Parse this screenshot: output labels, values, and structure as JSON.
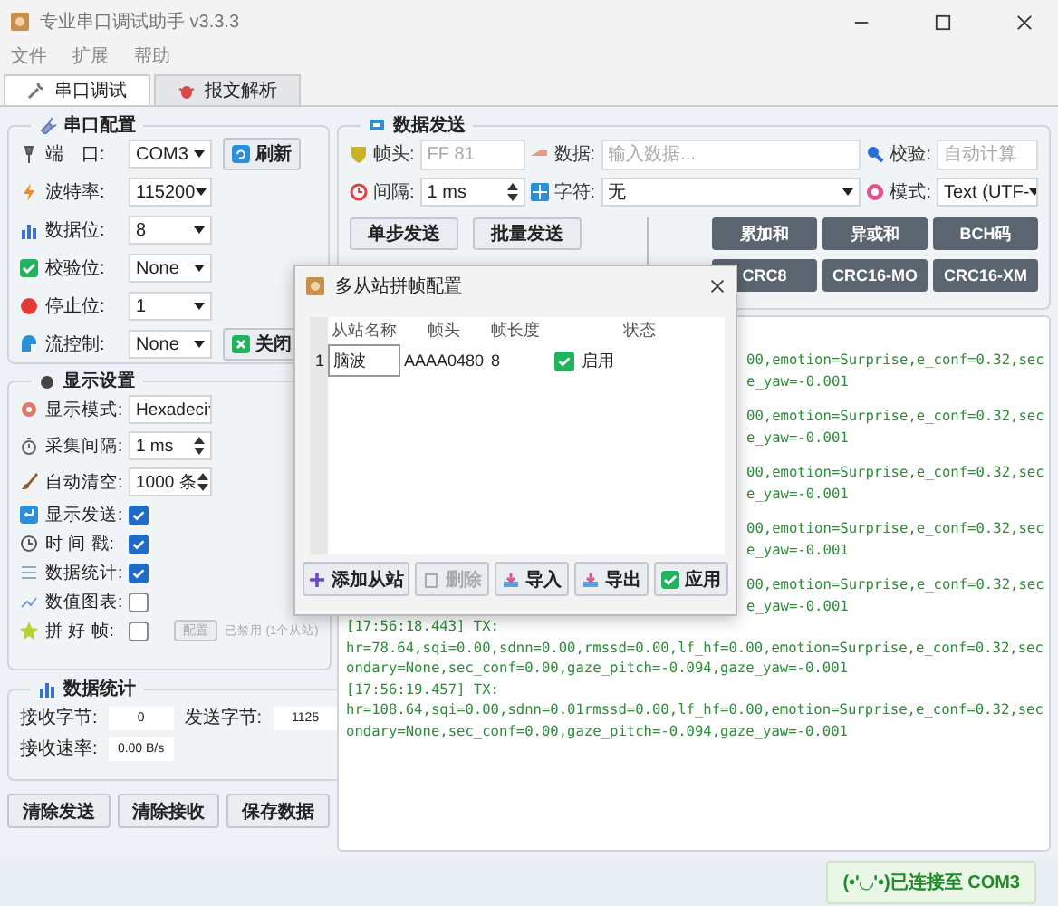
{
  "window": {
    "title": "专业串口调试助手 v3.3.3"
  },
  "menu": [
    "文件",
    "扩展",
    "帮助"
  ],
  "tabs": [
    {
      "label": "串口调试",
      "selected": true
    },
    {
      "label": "报文解析",
      "selected": false
    }
  ],
  "serial_config": {
    "title": "串口配置",
    "fields": [
      {
        "label": "端　口:",
        "value": "COM3"
      },
      {
        "label": "波特率:",
        "value": "115200"
      },
      {
        "label": "数据位:",
        "value": "8"
      },
      {
        "label": "校验位:",
        "value": "None"
      },
      {
        "label": "停止位:",
        "value": "1"
      },
      {
        "label": "流控制:",
        "value": "None"
      }
    ],
    "refresh_button": "刷新",
    "close_button": "关闭"
  },
  "display_settings": {
    "title": "显示设置",
    "mode": {
      "label": "显示模式:",
      "value": "Hexadeci"
    },
    "spins": [
      {
        "label": "采集间隔:",
        "value": "1 ms"
      },
      {
        "label": "自动清空:",
        "value": "1000 条"
      }
    ],
    "checks": [
      {
        "label": "显示发送:",
        "checked": true
      },
      {
        "label": "时 间 戳:",
        "checked": true
      },
      {
        "label": "数据统计:",
        "checked": true
      },
      {
        "label": "数值图表:",
        "checked": false
      },
      {
        "label": "拼 好 帧:",
        "checked": false
      }
    ],
    "frame_config_button": {
      "label": "配置",
      "disabled": true
    },
    "frame_status": "已禁用 (1个从站)"
  },
  "stats": {
    "title": "数据统计",
    "rows": [
      {
        "label": "接收字节:",
        "value": "0"
      },
      {
        "label": "发送字节:",
        "value": "1125"
      },
      {
        "label": "接收速率:",
        "value": "0.00 B/s"
      }
    ]
  },
  "actions": [
    "清除发送",
    "清除接收",
    "保存数据"
  ],
  "send": {
    "title": "数据发送",
    "header": {
      "label": "帧头:",
      "placeholder": "FF 81"
    },
    "data": {
      "label": "数据:",
      "placeholder": "输入数据..."
    },
    "checksum": {
      "label": "校验:",
      "placeholder": "自动计算"
    },
    "interval": {
      "label": "间隔:",
      "value": "1 ms"
    },
    "charset": {
      "label": "字符:",
      "value": "无"
    },
    "mode": {
      "label": "模式:",
      "value": "Text (UTF-"
    },
    "send_buttons": [
      "单步发送",
      "批量发送"
    ],
    "checksum_buttons": [
      "累加和",
      "异或和",
      "BCH码",
      "CRC8",
      "CRC16-MO",
      "CRC16-XM"
    ]
  },
  "log": [
    {
      "kind": "fragment",
      "lines": [
        "00,emotion=Surprise,e_conf=0.32,sec",
        "e_yaw=-0.001"
      ]
    },
    {
      "kind": "fragment",
      "lines": [
        "00,emotion=Surprise,e_conf=0.32,sec",
        "e_yaw=-0.001"
      ]
    },
    {
      "kind": "fragment",
      "lines": [
        "00,emotion=Surprise,e_conf=0.32,sec",
        "e_yaw=-0.001"
      ]
    },
    {
      "kind": "fragment",
      "lines": [
        "00,emotion=Surprise,e_conf=0.32,sec",
        "e_yaw=-0.001"
      ]
    },
    {
      "kind": "fragment",
      "lines": [
        "00,emotion=Surprise,e_conf=0.32,sec",
        "e_yaw=-0.001"
      ]
    },
    {
      "kind": "full",
      "lines": [
        "[17:56:18.443] TX:",
        "hr=78.64,sqi=0.00,sdnn=0.00,rmssd=0.00,lf_hf=0.00,emotion=Surprise,e_conf=0.32,sec",
        "ondary=None,sec_conf=0.00,gaze_pitch=-0.094,gaze_yaw=-0.001"
      ]
    },
    {
      "kind": "full",
      "lines": [
        "[17:56:19.457] TX:",
        "hr=108.64,sqi=0.00,sdnn=0.01rmssd=0.00,lf_hf=0.00,emotion=Surprise,e_conf=0.32,sec",
        "ondary=None,sec_conf=0.00,gaze_pitch=-0.094,gaze_yaw=-0.001"
      ]
    }
  ],
  "dialog": {
    "title": "多从站拼帧配置",
    "columns": [
      "从站名称",
      "帧头",
      "帧长度",
      "状态"
    ],
    "rows": [
      {
        "index": "1",
        "name": "脑波",
        "header": "AAAA0480",
        "length": "8",
        "status": {
          "label": "启用",
          "checked": true
        }
      }
    ],
    "buttons": [
      {
        "label": "添加从站",
        "disabled": false
      },
      {
        "label": "删除",
        "disabled": true
      },
      {
        "label": "导入",
        "disabled": false
      },
      {
        "label": "导出",
        "disabled": false
      },
      {
        "label": "应用",
        "disabled": false
      }
    ]
  },
  "status": "(•'◡'•)已连接至 COM3"
}
